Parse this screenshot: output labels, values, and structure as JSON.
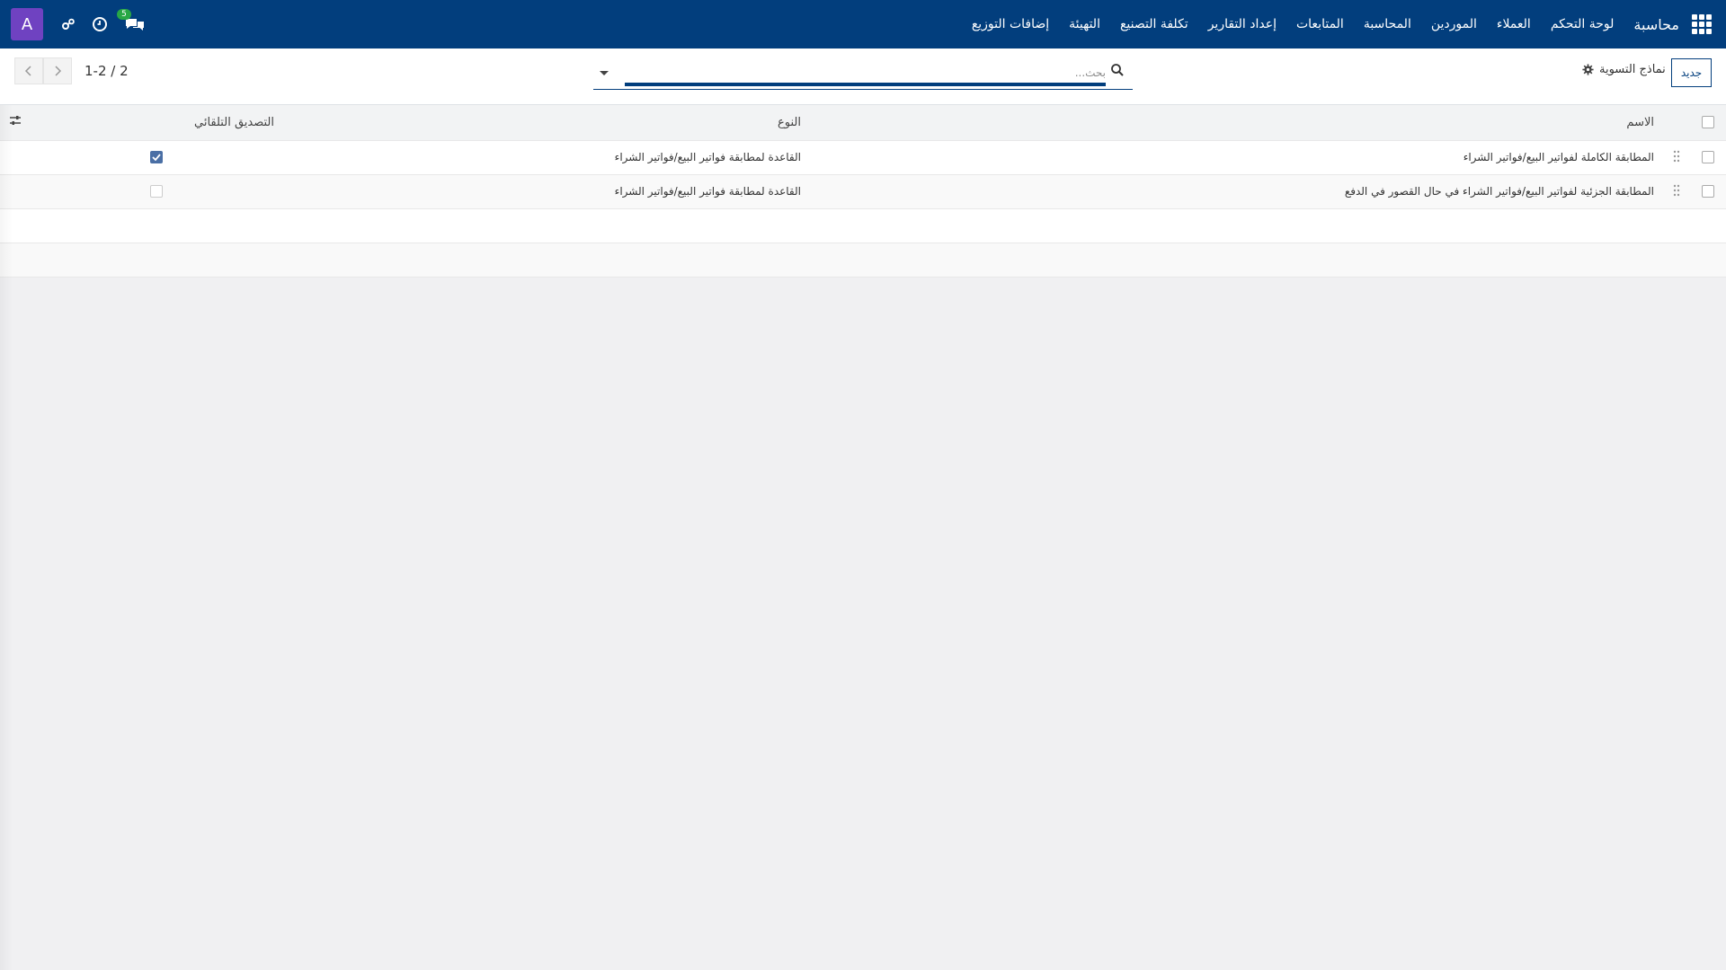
{
  "navbar": {
    "brand": "محاسبة",
    "menu": [
      "لوحة التحكم",
      "العملاء",
      "الموردين",
      "المحاسبة",
      "المتابعات",
      "إعداد التقارير",
      "تكلفة التصنيع",
      "التهيئة",
      "إضافات التوزيع"
    ],
    "messages_count": "5",
    "avatar_letter": "A"
  },
  "control_panel": {
    "new_button": "جديد",
    "breadcrumb": "نماذج التسوية",
    "search_placeholder": "بحث...",
    "pager": "1-2 / 2"
  },
  "table": {
    "columns": {
      "name": "الاسم",
      "type": "النوع",
      "auto_validate": "التصديق التلقائي"
    },
    "rows": [
      {
        "name": "المطابقة الكاملة لفواتير البيع/فواتير الشراء",
        "type": "القاعدة لمطابقة فواتير البيع/فواتير الشراء",
        "auto_validate": true
      },
      {
        "name": "المطابقة الجزئية لفواتير البيع/فواتير الشراء في حال القصور في الدفع",
        "type": "القاعدة لمطابقة فواتير البيع/فواتير الشراء",
        "auto_validate": false
      }
    ]
  },
  "colors": {
    "navbar": "#023e7d",
    "avatar": "#6f42c1",
    "badge": "#28a745",
    "checkbox_checked": "#4a6fa5"
  },
  "icons": [
    "apps-grid-icon",
    "chat-icon",
    "clock-icon",
    "debug-icon",
    "search-icon",
    "caret-down-icon",
    "chevron-left-icon",
    "chevron-right-icon",
    "gear-icon",
    "drag-handle-icon",
    "optional-columns-icon"
  ]
}
